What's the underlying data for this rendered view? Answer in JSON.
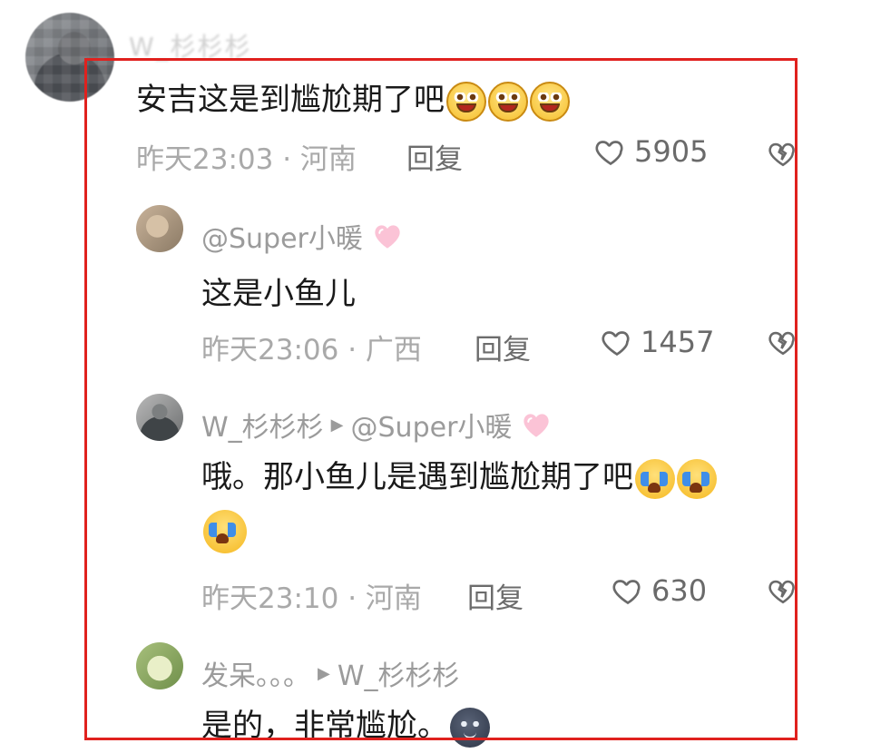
{
  "top": {
    "blurred_name": "W_杉杉杉"
  },
  "comments": [
    {
      "text": "安吉这是到尴尬期了吧",
      "emojis": [
        "grin",
        "grin",
        "grin"
      ],
      "meta": "昨天23:03 · 河南",
      "reply": "回复",
      "likes": "5905"
    },
    {
      "user": "@Super小暖",
      "text": "这是小鱼儿",
      "meta": "昨天23:06 · 广西",
      "reply": "回复",
      "likes": "1457"
    },
    {
      "user": "W_杉杉杉",
      "reply_to": "@Super小暖",
      "text": "哦。那小鱼儿是遇到尴尬期了吧",
      "emojis": [
        "cry",
        "cry",
        "cry"
      ],
      "meta": "昨天23:10 · 河南",
      "reply": "回复",
      "likes": "630"
    },
    {
      "user": "发呆。。。",
      "reply_to": "W_杉杉杉",
      "text": "是的，非常尴尬。",
      "emojis": [
        "moon"
      ]
    }
  ],
  "colors": {
    "frame": "#e0211e",
    "meta": "#a9a9a9",
    "username": "#9b9b9b"
  },
  "icons": {
    "like": "heart-icon",
    "dislike": "broken-heart-icon",
    "reply_arrow": "triangle-right-icon"
  }
}
